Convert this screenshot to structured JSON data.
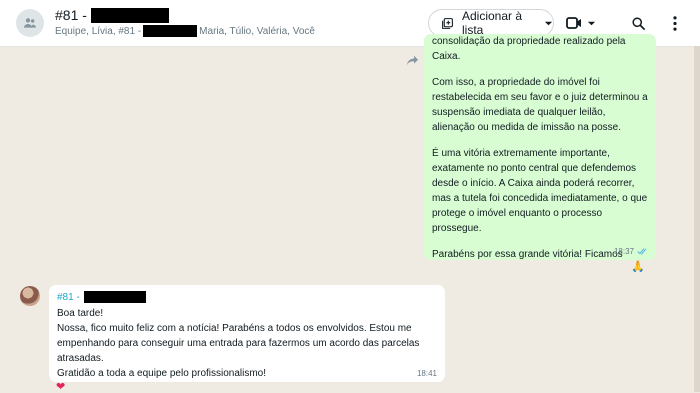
{
  "header": {
    "title": "#81 -",
    "subtitle_before": "Equipe, Lívia, #81 -",
    "subtitle_after": "Maria, Túlio, Valéria, Você",
    "add_to_list_label": "Adicionar à lista"
  },
  "messages": {
    "outgoing": {
      "paragraphs": [
        "consolidação da propriedade realizado pela Caixa.",
        "Com isso, a propriedade do imóvel foi restabelecida em seu favor e o juiz determinou a suspensão imediata de qualquer leilão, alienação ou medida de imissão na posse.",
        "É uma vitória extremamente importante, exatamente no ponto central que defendemos desde o início. A Caixa ainda poderá recorrer, mas a tutela foi concedida imediatamente, o que protege o imóvel enquanto o processo prossegue.",
        "Parabéns por essa grande vitória! Ficamos muito felizes com esse resultado."
      ],
      "time": "18:37",
      "reaction": "🙏"
    },
    "incoming": {
      "sender": "#81 -",
      "lines": [
        "Boa tarde!",
        "Nossa, fico muito feliz com a notícia! Parabéns a todos os envolvidos. Estou me",
        "empenhando para conseguir uma entrada para  fazermos um acordo das parcelas",
        "atrasadas.",
        "Gratidão a toda a equipe pelo profissionalismo!"
      ],
      "time": "18:41",
      "reaction": "❤"
    }
  },
  "colors": {
    "outgoing_bubble": "#d9fdd3",
    "incoming_bubble": "#ffffff",
    "chat_background": "#efeae2",
    "sender_name": "#1fa4c9",
    "read_ticks": "#53bdeb"
  },
  "icons": [
    "group-icon",
    "add-list-icon",
    "chevron-down-icon",
    "video-icon",
    "search-icon",
    "menu-icon",
    "forward-icon",
    "double-check-icon"
  ]
}
